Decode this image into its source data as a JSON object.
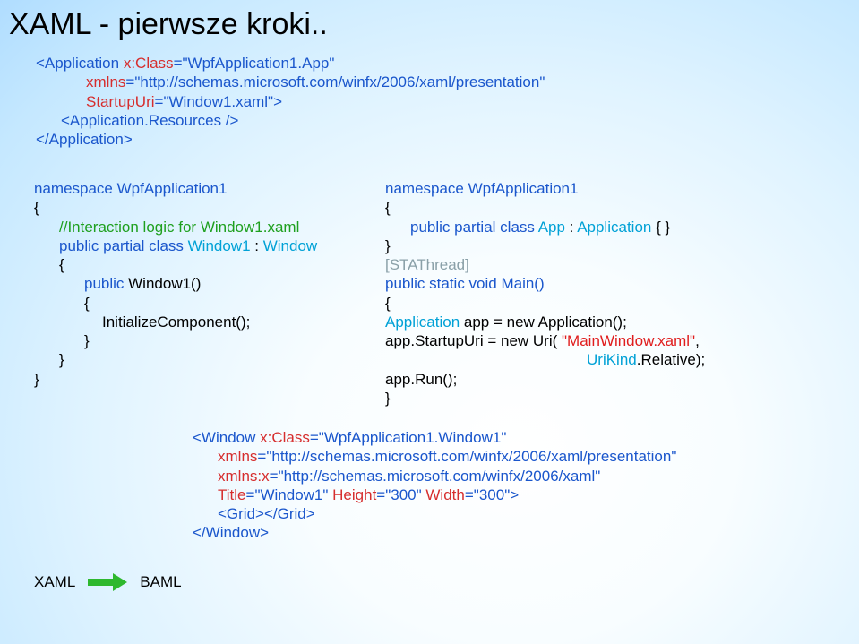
{
  "title": "XAML - pierwsze kroki..",
  "xaml_app": {
    "l1a": "<Application ",
    "l1b": "x:Class",
    "l1c": "=",
    "l1d": "\"WpfApplication1.App\"",
    "l2a": "xmlns",
    "l2b": "=",
    "l2c": "\"http://schemas.microsoft.com/winfx/2006/xaml/presentation\"",
    "l3a": "StartupUri",
    "l3b": "=",
    "l3c": "\"Window1.xaml\"",
    "l3d": ">",
    "l4a": "<Application.Resources ",
    "l4b": "/>",
    "l5": "</Application>"
  },
  "code1": {
    "l1": "namespace WpfApplication1",
    "l2": "{",
    "l3a": "//Interaction logic for ",
    "l3b": "Window1.xaml",
    "l4a": "public partial class ",
    "l4b": "Window1 ",
    "l4c": ": ",
    "l4d": "Window",
    "l5": "{",
    "l6a": "public ",
    "l6b": "Window1()",
    "l7": "{",
    "l8": "InitializeComponent();",
    "l9": "}",
    "l10": "}",
    "l11": "}"
  },
  "code2": {
    "l1": "namespace WpfApplication1",
    "l2": "{",
    "l3a": "public partial class ",
    "l3b": "App ",
    "l3c": ": ",
    "l3d": "Application ",
    "l3e": "{ }",
    "l4": "}",
    "gap": " ",
    "l5": "[STAThread]",
    "l6": "public static void Main()",
    "l7": "{",
    "l8a": "Application ",
    "l8b": "app = new ",
    "l8c": "Application();",
    "l9a": "app.StartupUri = new ",
    "l9b": "Uri( ",
    "l9c": "\"MainWindow.xaml\"",
    "l9d": ",",
    "l10a": "UriKind",
    "l10b": ".Relative);",
    "l11": "app.Run();",
    "l12": "}"
  },
  "code3": {
    "l1a": "<Window ",
    "l1b": "x:Class",
    "l1c": "=",
    "l1d": "\"WpfApplication1.Window1\"",
    "l2a": "xmlns",
    "l2b": "=",
    "l2c": "\"http://schemas.microsoft.com/winfx/2006/xaml/presentation\"",
    "l3a": "xmlns:x",
    "l3b": "=",
    "l3c": "\"http://schemas.microsoft.com/winfx/2006/xaml\"",
    "l4a": "Title",
    "l4b": "=",
    "l4c": "\"Window1\" ",
    "l4d": "Height",
    "l4e": "=",
    "l4f": "\"300\" ",
    "l4g": "Width",
    "l4h": "=",
    "l4i": "\"300\"",
    "l4j": ">",
    "l5a": "<Grid></Grid>",
    "l6": "</Window>"
  },
  "footer": {
    "xaml": "XAML",
    "baml": "BAML"
  }
}
